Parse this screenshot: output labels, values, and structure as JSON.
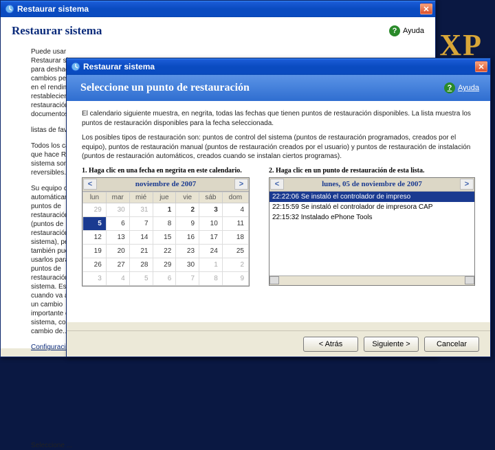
{
  "bg_xp": "XP",
  "win1": {
    "title": "Restaurar sistema",
    "header_title": "Restaurar sistema",
    "help_label": "Ayuda",
    "para_intro": "Puede usar Restaurar sistema para deshacer cambios peligrosos en el rendimiento restableciendo la restauración de documentos.",
    "para_lists": "listas de favoritos.",
    "para_todos": "Todos los cambios que hace Restaurar sistema son reversibles.",
    "para_equipo": "Su equipo crea automáticamente puntos de restauración (puntos de restauración del sistema), pero también puede usarlos para crear puntos de restauración del sistema. Esto es útil cuando va a hacer un cambio importante en su sistema, como el cambio de...",
    "link_config": "Configuración",
    "footer_seleccione": "Seleccione ..."
  },
  "win2": {
    "title": "Restaurar sistema",
    "help_label": "Ayuda",
    "header_title": "Seleccione un punto de restauración",
    "desc1": "El calendario siguiente muestra, en negrita, todas las fechas que tienen puntos de restauración disponibles. La lista muestra los puntos de restauración disponibles para la fecha seleccionada.",
    "desc2": "Los posibles tipos de restauración son: puntos de control del sistema (puntos de restauración programados, creados por el equipo), puntos de restauración manual (puntos de restauración creados por el usuario) y puntos de restauración de instalación (puntos de restauración automáticos, creados cuando se instalan ciertos programas).",
    "col1_label": "1. Haga clic en una fecha en negrita en este calendario.",
    "col2_label": "2. Haga clic en un punto de restauración de esta lista.",
    "calendar": {
      "prev": "<",
      "next": ">",
      "month": "noviembre de 2007",
      "dow": [
        "lun",
        "mar",
        "mié",
        "jue",
        "vie",
        "sáb",
        "dom"
      ],
      "weeks": [
        [
          {
            "d": "29",
            "dim": true
          },
          {
            "d": "30",
            "dim": true
          },
          {
            "d": "31",
            "dim": true
          },
          {
            "d": "1",
            "bold": true
          },
          {
            "d": "2",
            "bold": true
          },
          {
            "d": "3",
            "bold": true
          },
          {
            "d": "4"
          }
        ],
        [
          {
            "d": "5",
            "sel": true,
            "bold": true
          },
          {
            "d": "6"
          },
          {
            "d": "7"
          },
          {
            "d": "8"
          },
          {
            "d": "9"
          },
          {
            "d": "10"
          },
          {
            "d": "11"
          }
        ],
        [
          {
            "d": "12"
          },
          {
            "d": "13"
          },
          {
            "d": "14"
          },
          {
            "d": "15"
          },
          {
            "d": "16"
          },
          {
            "d": "17"
          },
          {
            "d": "18"
          }
        ],
        [
          {
            "d": "19"
          },
          {
            "d": "20"
          },
          {
            "d": "21"
          },
          {
            "d": "22"
          },
          {
            "d": "23"
          },
          {
            "d": "24"
          },
          {
            "d": "25"
          }
        ],
        [
          {
            "d": "26"
          },
          {
            "d": "27"
          },
          {
            "d": "28"
          },
          {
            "d": "29"
          },
          {
            "d": "30"
          },
          {
            "d": "1",
            "dim": true
          },
          {
            "d": "2",
            "dim": true
          }
        ],
        [
          {
            "d": "3",
            "dim": true
          },
          {
            "d": "4",
            "dim": true
          },
          {
            "d": "5",
            "dim": true
          },
          {
            "d": "6",
            "dim": true
          },
          {
            "d": "7",
            "dim": true
          },
          {
            "d": "8",
            "dim": true
          },
          {
            "d": "9",
            "dim": true
          }
        ]
      ]
    },
    "rplist": {
      "prev": "<",
      "next": ">",
      "date": "lunes, 05 de noviembre de 2007",
      "items": [
        {
          "text": "22:22:06  Se instaló el controlador de impreso",
          "sel": true
        },
        {
          "text": "22:15:59  Se instaló el controlador de impresora CAP"
        },
        {
          "text": "22:15:32  Instalado ePhone Tools"
        }
      ]
    },
    "buttons": {
      "back": "<  Atrás",
      "next": "Siguiente  >",
      "cancel": "Cancelar"
    }
  }
}
